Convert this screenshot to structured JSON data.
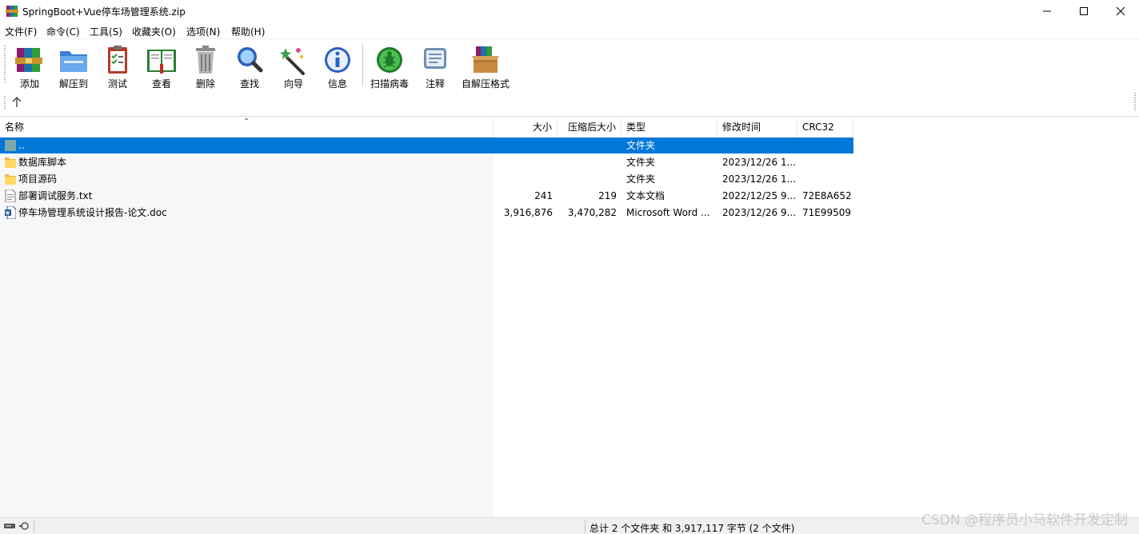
{
  "window": {
    "title": "SpringBoot+Vue停车场管理系统.zip",
    "app_icon": "winrar-books-icon",
    "controls": [
      "minimize-icon",
      "maximize-icon",
      "close-icon"
    ]
  },
  "menu": [
    {
      "label": "文件(F)"
    },
    {
      "label": "命令(C)"
    },
    {
      "label": "工具(S)"
    },
    {
      "label": "收藏夹(O)"
    },
    {
      "label": "选项(N)"
    },
    {
      "label": "帮助(H)"
    }
  ],
  "toolbar": [
    {
      "label": "添加",
      "icon": "add-archive-icon"
    },
    {
      "label": "解压到",
      "icon": "extract-folder-icon"
    },
    {
      "label": "测试",
      "icon": "test-clipboard-icon"
    },
    {
      "label": "查看",
      "icon": "view-book-icon"
    },
    {
      "label": "删除",
      "icon": "trash-icon"
    },
    {
      "label": "查找",
      "icon": "magnifier-icon"
    },
    {
      "label": "向导",
      "icon": "wizard-wand-icon"
    },
    {
      "label": "信息",
      "icon": "info-icon"
    },
    {
      "label": "扫描病毒",
      "icon": "virus-scan-icon"
    },
    {
      "label": "注释",
      "icon": "comment-icon"
    },
    {
      "label": "自解压格式",
      "icon": "sfx-box-icon"
    }
  ],
  "columns": [
    {
      "label": "名称"
    },
    {
      "label": "大小"
    },
    {
      "label": "压缩后大小"
    },
    {
      "label": "类型"
    },
    {
      "label": "修改时间"
    },
    {
      "label": "CRC32"
    }
  ],
  "files": [
    {
      "name": "..",
      "size": "",
      "packed": "",
      "type": "文件夹",
      "modified": "",
      "crc": "",
      "icon": "parent-folder-icon",
      "selected": true
    },
    {
      "name": "数据库脚本",
      "size": "",
      "packed": "",
      "type": "文件夹",
      "modified": "2023/12/26 1...",
      "crc": "",
      "icon": "folder-icon",
      "selected": false
    },
    {
      "name": "项目源码",
      "size": "",
      "packed": "",
      "type": "文件夹",
      "modified": "2023/12/26 1...",
      "crc": "",
      "icon": "folder-icon",
      "selected": false
    },
    {
      "name": "部署调试服务.txt",
      "size": "241",
      "packed": "219",
      "type": "文本文档",
      "modified": "2022/12/25 9...",
      "crc": "72E8A652",
      "icon": "text-file-icon",
      "selected": false
    },
    {
      "name": "停车场管理系统设计报告-论文.doc",
      "size": "3,916,876",
      "packed": "3,470,282",
      "type": "Microsoft Word ...",
      "modified": "2023/12/26 9...",
      "crc": "71E99509",
      "icon": "word-doc-icon",
      "selected": false
    }
  ],
  "status": {
    "summary": "总计 2 个文件夹 和 3,917,117 字节 (2 个文件)"
  },
  "watermark": "CSDN @程序员小马软件开发定制",
  "colors": {
    "selection": "#0078d7",
    "folder": "#ffd867"
  }
}
